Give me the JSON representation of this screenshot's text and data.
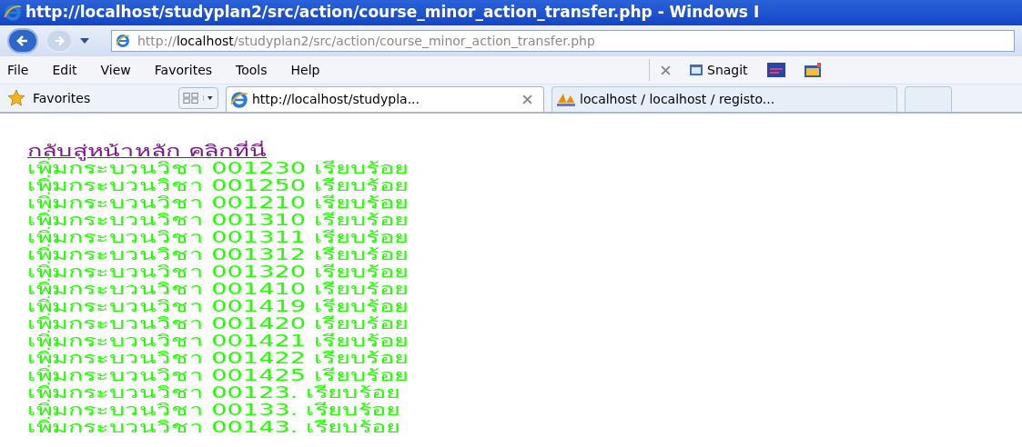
{
  "window": {
    "title": "http://localhost/studyplan2/src/action/course_minor_action_transfer.php - Windows I"
  },
  "address_bar": {
    "host_prefix": "http://",
    "host": "localhost",
    "path": "/studyplan2/src/action/course_minor_action_transfer.php"
  },
  "menu_bar": [
    "File",
    "Edit",
    "View",
    "Favorites",
    "Tools",
    "Help"
  ],
  "toolbar": {
    "snagit_label": "Snagit"
  },
  "favorites_bar": {
    "favorites_label": "Favorites"
  },
  "tabs": [
    {
      "label": "http://localhost/studypla...",
      "selected": true,
      "kind": "ie"
    },
    {
      "label": "localhost / localhost / registo...",
      "selected": false,
      "kind": "pma"
    },
    {
      "selected": false,
      "kind": "new"
    }
  ],
  "page": {
    "back_link": "กลับสู่หน้าหลัก คลิกที่นี่",
    "messages": [
      "เพิ่มกระบวนวิชา 001230 เรียบร้อย",
      "เพิ่มกระบวนวิชา 001250 เรียบร้อย",
      "เพิ่มกระบวนวิชา 001210 เรียบร้อย",
      "เพิ่มกระบวนวิชา 001310 เรียบร้อย",
      "เพิ่มกระบวนวิชา 001311 เรียบร้อย",
      "เพิ่มกระบวนวิชา 001312 เรียบร้อย",
      "เพิ่มกระบวนวิชา 001320 เรียบร้อย",
      "เพิ่มกระบวนวิชา 001410 เรียบร้อย",
      "เพิ่มกระบวนวิชา 001419 เรียบร้อย",
      "เพิ่มกระบวนวิชา 001420 เรียบร้อย",
      "เพิ่มกระบวนวิชา 001421 เรียบร้อย",
      "เพิ่มกระบวนวิชา 001422 เรียบร้อย",
      "เพิ่มกระบวนวิชา 001425 เรียบร้อย",
      "เพิ่มกระบวนวิชา 00123. เรียบร้อย",
      "เพิ่มกระบวนวิชา 00133. เรียบร้อย",
      "เพิ่มกระบวนวิชา 00143. เรียบร้อย"
    ]
  }
}
